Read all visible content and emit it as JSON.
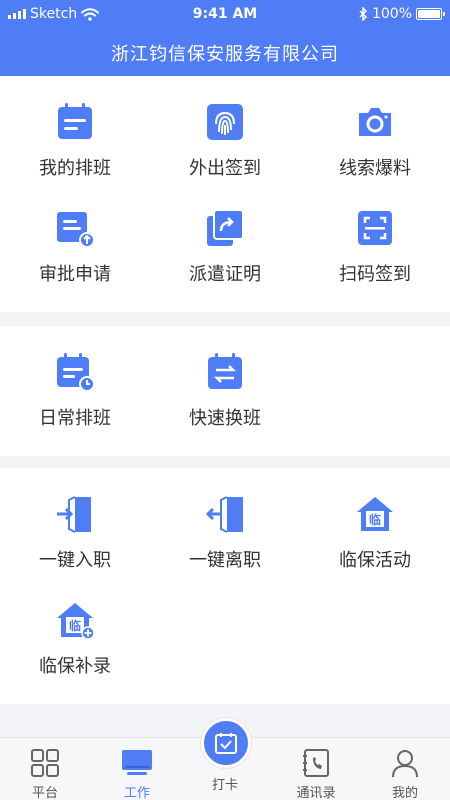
{
  "status": {
    "carrier": "Sketch",
    "time": "9:41 AM",
    "battery": "100%"
  },
  "header": {
    "title": "浙江钧信保安服务有限公司"
  },
  "section1": [
    {
      "label": "我的排班",
      "icon": "schedule-icon"
    },
    {
      "label": "外出签到",
      "icon": "fingerprint-icon"
    },
    {
      "label": "线索爆料",
      "icon": "camera-icon"
    },
    {
      "label": "审批申请",
      "icon": "upload-doc-icon"
    },
    {
      "label": "派遣证明",
      "icon": "share-doc-icon"
    },
    {
      "label": "扫码签到",
      "icon": "scan-icon"
    }
  ],
  "section2": [
    {
      "label": "日常排班",
      "icon": "calendar-clock-icon"
    },
    {
      "label": "快速换班",
      "icon": "swap-calendar-icon"
    }
  ],
  "section3": [
    {
      "label": "一键入职",
      "icon": "door-enter-icon"
    },
    {
      "label": "一键离职",
      "icon": "door-exit-icon"
    },
    {
      "label": "临保活动",
      "icon": "house-icon",
      "badge": "临"
    },
    {
      "label": "临保补录",
      "icon": "house-plus-icon",
      "badge": "临"
    }
  ],
  "tabs": [
    {
      "label": "平台",
      "icon": "grid-icon"
    },
    {
      "label": "工作",
      "icon": "monitor-icon",
      "active": true
    },
    {
      "label": "打卡",
      "icon": "checkin-icon"
    },
    {
      "label": "通讯录",
      "icon": "phonebook-icon"
    },
    {
      "label": "我的",
      "icon": "user-icon"
    }
  ],
  "colors": {
    "primary": "#4f7df5",
    "background": "#f3f4f8"
  }
}
